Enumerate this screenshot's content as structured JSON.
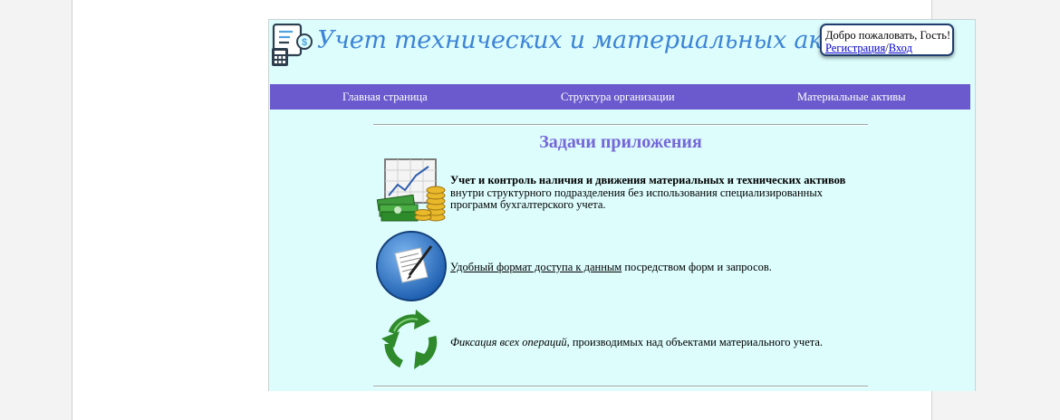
{
  "header": {
    "title": "Учет технических и материальных активов",
    "welcome_text": "Добро пожаловать, Гость!",
    "register_link": "Регистрация",
    "separator": "/",
    "login_link": "Вход"
  },
  "nav": {
    "items": [
      {
        "label": "Главная страница"
      },
      {
        "label": "Структура организации"
      },
      {
        "label": "Материальные активы"
      }
    ]
  },
  "main": {
    "heading": "Задачи приложения",
    "tasks": [
      {
        "icon": "chart-money-icon",
        "bold": "Учет и контроль наличия и движения материальных и технических активов",
        "text": " внутри структурного подразделения без использования специализированных программ бухгалтерского учета."
      },
      {
        "icon": "document-pen-icon",
        "underlined": "Удобный формат доступа к данным",
        "text": " посредством форм и запросов."
      },
      {
        "icon": "recycle-arrows-icon",
        "italic": "Фиксация всех операций",
        "text": ", производимых над объектами материального учета."
      }
    ]
  },
  "colors": {
    "header_title": "#3d84d6",
    "nav_bg": "#6a5acd",
    "content_bg": "#ddfdfd",
    "heading": "#7567d9"
  }
}
